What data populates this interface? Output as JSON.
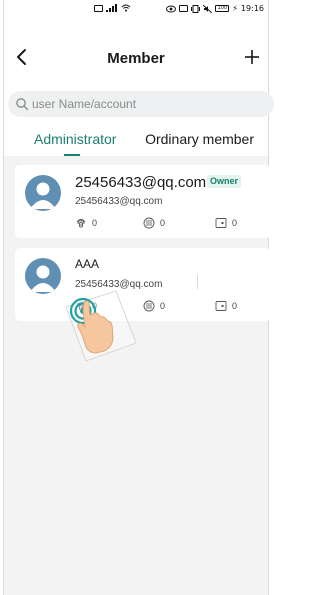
{
  "status_bar": {
    "left_icons": [
      "sim-icon",
      "signal-icon",
      "wifi-icon"
    ],
    "right_icons": [
      "eye-icon",
      "nfc-icon",
      "vibrate-icon",
      "mute-icon"
    ],
    "battery": "100",
    "time": "19:16"
  },
  "header": {
    "title": "Member",
    "back_icon": "chevron-left-icon",
    "add_icon": "plus-icon"
  },
  "search": {
    "placeholder": "user Name/account",
    "value": ""
  },
  "tabs": [
    {
      "label": "Administrator",
      "active": true
    },
    {
      "label": "Ordinary member",
      "active": false
    }
  ],
  "members": [
    {
      "name": "25456433@qq.com",
      "badge": "Owner",
      "account": "25456433@qq.com",
      "fingerprint_count": "0",
      "password_count": "0",
      "card_count": "0"
    },
    {
      "name": "AAA",
      "badge": "",
      "account": "25456433@qq.com",
      "fingerprint_count": "0",
      "password_count": "0",
      "card_count": "0"
    }
  ],
  "colors": {
    "accent": "#1a7f6e",
    "badge_bg": "#e3f4ee",
    "avatar": "#5f8fb3",
    "list_bg": "#f3f3f3"
  }
}
